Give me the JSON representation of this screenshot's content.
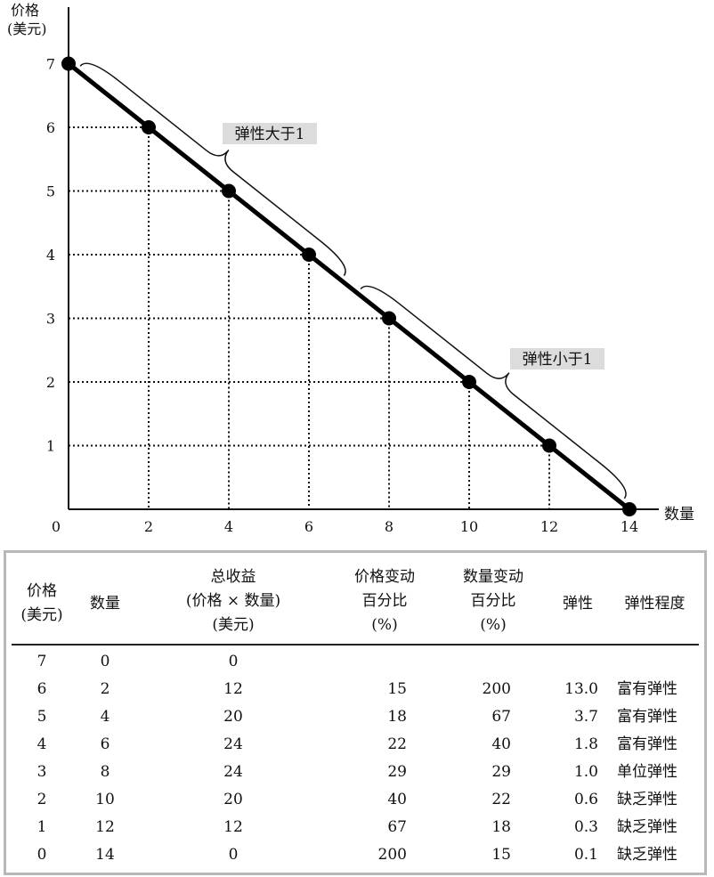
{
  "chart_data": {
    "type": "line",
    "ylabel_line1": "价格",
    "ylabel_line2": "(美元)",
    "xlabel": "数量",
    "origin_label": "0",
    "x_ticks": [
      "2",
      "4",
      "6",
      "8",
      "10",
      "12",
      "14"
    ],
    "y_ticks": [
      "1",
      "2",
      "3",
      "4",
      "5",
      "6",
      "7"
    ],
    "xlim": [
      0,
      14
    ],
    "ylim": [
      0,
      7
    ],
    "points": [
      {
        "x": 0,
        "y": 7
      },
      {
        "x": 2,
        "y": 6
      },
      {
        "x": 4,
        "y": 5
      },
      {
        "x": 6,
        "y": 4
      },
      {
        "x": 8,
        "y": 3
      },
      {
        "x": 10,
        "y": 2
      },
      {
        "x": 12,
        "y": 1
      },
      {
        "x": 14,
        "y": 0
      }
    ],
    "annotations": [
      {
        "text": "弹性大于1",
        "range_x": [
          0,
          7
        ]
      },
      {
        "text": "弹性小于1",
        "range_x": [
          7,
          14
        ]
      }
    ],
    "gridlines": "dotted drop lines to axes at each point",
    "line_color": "#000000"
  },
  "table": {
    "headers": {
      "price": [
        "价格",
        "(美元)"
      ],
      "quantity": [
        "数量"
      ],
      "revenue": [
        "总收益",
        "(价格 × 数量)",
        "(美元)"
      ],
      "price_change": [
        "价格变动",
        "百分比",
        "(%)"
      ],
      "quantity_change": [
        "数量变动",
        "百分比",
        "(%)"
      ],
      "elasticity": [
        "弹性"
      ],
      "degree": [
        "弹性程度"
      ]
    },
    "rows": [
      {
        "price": "7",
        "quantity": "0",
        "revenue": "0",
        "price_change": "",
        "quantity_change": "",
        "elasticity": "",
        "degree": ""
      },
      {
        "price": "6",
        "quantity": "2",
        "revenue": "12",
        "price_change": "15",
        "quantity_change": "200",
        "elasticity": "13.0",
        "degree": "富有弹性"
      },
      {
        "price": "5",
        "quantity": "4",
        "revenue": "20",
        "price_change": "18",
        "quantity_change": "67",
        "elasticity": "3.7",
        "degree": "富有弹性"
      },
      {
        "price": "4",
        "quantity": "6",
        "revenue": "24",
        "price_change": "22",
        "quantity_change": "40",
        "elasticity": "1.8",
        "degree": "富有弹性"
      },
      {
        "price": "3",
        "quantity": "8",
        "revenue": "24",
        "price_change": "29",
        "quantity_change": "29",
        "elasticity": "1.0",
        "degree": "单位弹性"
      },
      {
        "price": "2",
        "quantity": "10",
        "revenue": "20",
        "price_change": "40",
        "quantity_change": "22",
        "elasticity": "0.6",
        "degree": "缺乏弹性"
      },
      {
        "price": "1",
        "quantity": "12",
        "revenue": "12",
        "price_change": "67",
        "quantity_change": "18",
        "elasticity": "0.3",
        "degree": "缺乏弹性"
      },
      {
        "price": "0",
        "quantity": "14",
        "revenue": "0",
        "price_change": "200",
        "quantity_change": "15",
        "elasticity": "0.1",
        "degree": "缺乏弹性"
      }
    ]
  }
}
